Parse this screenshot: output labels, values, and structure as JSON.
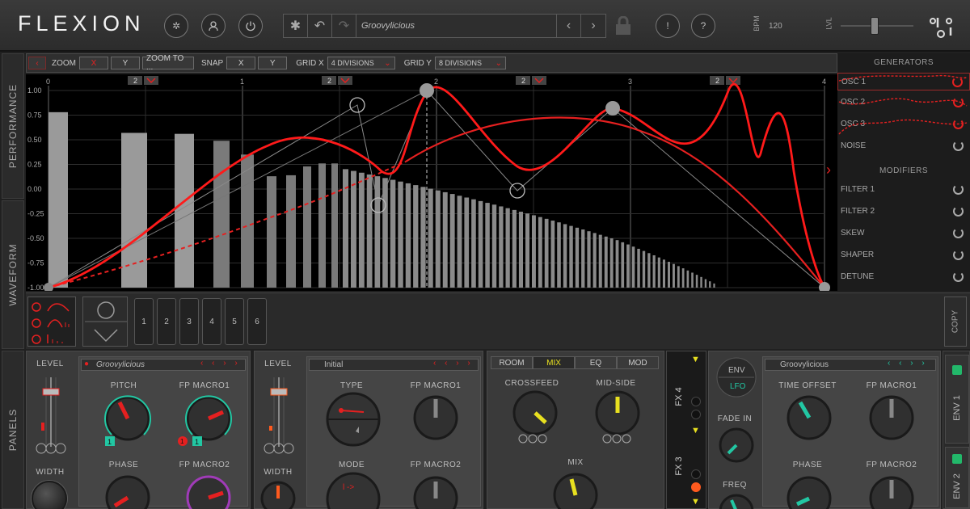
{
  "app": {
    "name": "FLEXION"
  },
  "topbar": {
    "preset_name": "Groovylicious",
    "bpm_label": "BPM",
    "bpm_value": "120",
    "lvl_label": "LVL",
    "info_label": "!",
    "help_label": "?"
  },
  "left_tabs": {
    "performance": "PERFORMANCE",
    "waveform": "WAVEFORM",
    "panels": "PANELS"
  },
  "toolbar": {
    "zoom": "ZOOM",
    "x": "X",
    "y": "Y",
    "zoom_to": "ZOOM TO ...",
    "snap": "SNAP",
    "grid_x": "GRID X",
    "grid_x_value": "4 DIVISIONS",
    "grid_y": "GRID Y",
    "grid_y_value": "8 DIVISIONS"
  },
  "graph": {
    "x_ticks": [
      "0",
      "1",
      "2",
      "3",
      "4"
    ],
    "y_ticks": [
      "1.00",
      "0.75",
      "0.50",
      "0.25",
      "0.00",
      "-0.25",
      "-0.50",
      "-0.75",
      "-1.00"
    ],
    "division_badges": [
      "2",
      "2",
      "2",
      "2"
    ]
  },
  "generators": {
    "title": "GENERATORS",
    "items": [
      {
        "label": "OSC 1",
        "on": true
      },
      {
        "label": "OSC 2",
        "on": true
      },
      {
        "label": "OSC 3",
        "on": true
      },
      {
        "label": "NOISE",
        "on": false
      }
    ]
  },
  "modifiers": {
    "title": "MODIFIERS",
    "items": [
      "FILTER 1",
      "FILTER 2",
      "SKEW",
      "SHAPER",
      "DETUNE"
    ]
  },
  "strip": {
    "slots": [
      "1",
      "2",
      "3",
      "4",
      "5",
      "6"
    ],
    "copy": "COPY"
  },
  "panel1": {
    "level": "LEVEL",
    "width": "WIDTH",
    "preset": "Groovylicious",
    "pitch": "PITCH",
    "macro1": "FP MACRO1",
    "phase": "PHASE",
    "macro2": "FP MACRO2",
    "badge1": "1",
    "badge2": "1",
    "badge3": "1"
  },
  "panel2": {
    "level": "LEVEL",
    "width": "WIDTH",
    "preset": "Initial",
    "type": "TYPE",
    "macro1": "FP MACRO1",
    "mode": "MODE",
    "macro2": "FP MACRO2"
  },
  "panel3": {
    "tabs": [
      "ROOM",
      "MIX",
      "EQ",
      "MOD"
    ],
    "active_tab": "MIX",
    "crossfeed": "CROSSFEED",
    "mid_side": "MID-SIDE",
    "mix": "MIX"
  },
  "fx": {
    "fx4": "FX 4",
    "fx3": "FX 3"
  },
  "panel4": {
    "env": "ENV",
    "lfo": "LFO",
    "fade_in": "FADE IN",
    "freq": "FREQ",
    "preset": "Groovylicious",
    "time_offset": "TIME OFFSET",
    "macro1": "FP MACRO1",
    "phase": "PHASE",
    "macro2": "FP MACRO2",
    "env1": "ENV 1",
    "env2": "ENV 2"
  },
  "colors": {
    "accent": "#e52020",
    "teal": "#22c7a3",
    "yellow": "#e8e020",
    "green": "#22b86a",
    "orange": "#ff5a1e"
  }
}
